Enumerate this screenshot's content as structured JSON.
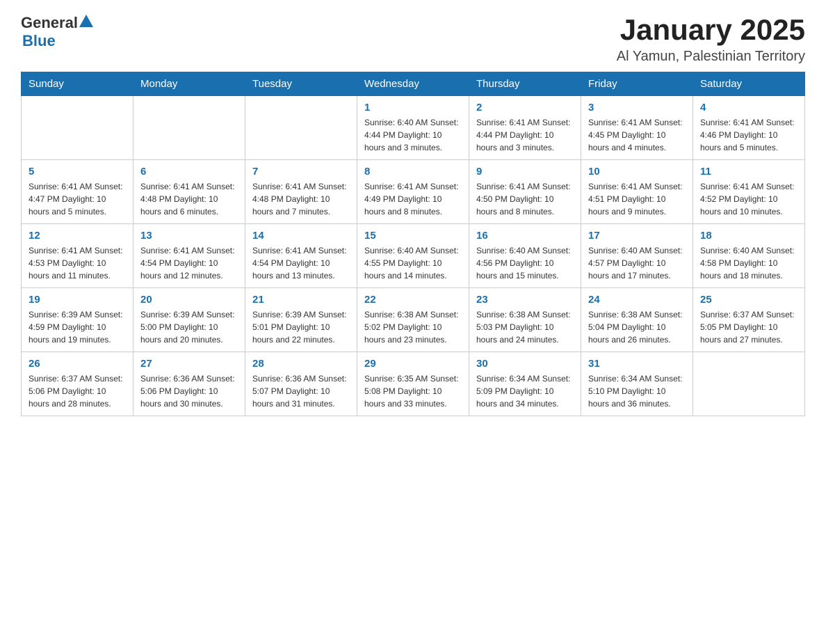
{
  "header": {
    "logo_general": "General",
    "logo_blue": "Blue",
    "month_title": "January 2025",
    "location": "Al Yamun, Palestinian Territory"
  },
  "weekdays": [
    "Sunday",
    "Monday",
    "Tuesday",
    "Wednesday",
    "Thursday",
    "Friday",
    "Saturday"
  ],
  "weeks": [
    [
      {
        "day": "",
        "info": ""
      },
      {
        "day": "",
        "info": ""
      },
      {
        "day": "",
        "info": ""
      },
      {
        "day": "1",
        "info": "Sunrise: 6:40 AM\nSunset: 4:44 PM\nDaylight: 10 hours\nand 3 minutes."
      },
      {
        "day": "2",
        "info": "Sunrise: 6:41 AM\nSunset: 4:44 PM\nDaylight: 10 hours\nand 3 minutes."
      },
      {
        "day": "3",
        "info": "Sunrise: 6:41 AM\nSunset: 4:45 PM\nDaylight: 10 hours\nand 4 minutes."
      },
      {
        "day": "4",
        "info": "Sunrise: 6:41 AM\nSunset: 4:46 PM\nDaylight: 10 hours\nand 5 minutes."
      }
    ],
    [
      {
        "day": "5",
        "info": "Sunrise: 6:41 AM\nSunset: 4:47 PM\nDaylight: 10 hours\nand 5 minutes."
      },
      {
        "day": "6",
        "info": "Sunrise: 6:41 AM\nSunset: 4:48 PM\nDaylight: 10 hours\nand 6 minutes."
      },
      {
        "day": "7",
        "info": "Sunrise: 6:41 AM\nSunset: 4:48 PM\nDaylight: 10 hours\nand 7 minutes."
      },
      {
        "day": "8",
        "info": "Sunrise: 6:41 AM\nSunset: 4:49 PM\nDaylight: 10 hours\nand 8 minutes."
      },
      {
        "day": "9",
        "info": "Sunrise: 6:41 AM\nSunset: 4:50 PM\nDaylight: 10 hours\nand 8 minutes."
      },
      {
        "day": "10",
        "info": "Sunrise: 6:41 AM\nSunset: 4:51 PM\nDaylight: 10 hours\nand 9 minutes."
      },
      {
        "day": "11",
        "info": "Sunrise: 6:41 AM\nSunset: 4:52 PM\nDaylight: 10 hours\nand 10 minutes."
      }
    ],
    [
      {
        "day": "12",
        "info": "Sunrise: 6:41 AM\nSunset: 4:53 PM\nDaylight: 10 hours\nand 11 minutes."
      },
      {
        "day": "13",
        "info": "Sunrise: 6:41 AM\nSunset: 4:54 PM\nDaylight: 10 hours\nand 12 minutes."
      },
      {
        "day": "14",
        "info": "Sunrise: 6:41 AM\nSunset: 4:54 PM\nDaylight: 10 hours\nand 13 minutes."
      },
      {
        "day": "15",
        "info": "Sunrise: 6:40 AM\nSunset: 4:55 PM\nDaylight: 10 hours\nand 14 minutes."
      },
      {
        "day": "16",
        "info": "Sunrise: 6:40 AM\nSunset: 4:56 PM\nDaylight: 10 hours\nand 15 minutes."
      },
      {
        "day": "17",
        "info": "Sunrise: 6:40 AM\nSunset: 4:57 PM\nDaylight: 10 hours\nand 17 minutes."
      },
      {
        "day": "18",
        "info": "Sunrise: 6:40 AM\nSunset: 4:58 PM\nDaylight: 10 hours\nand 18 minutes."
      }
    ],
    [
      {
        "day": "19",
        "info": "Sunrise: 6:39 AM\nSunset: 4:59 PM\nDaylight: 10 hours\nand 19 minutes."
      },
      {
        "day": "20",
        "info": "Sunrise: 6:39 AM\nSunset: 5:00 PM\nDaylight: 10 hours\nand 20 minutes."
      },
      {
        "day": "21",
        "info": "Sunrise: 6:39 AM\nSunset: 5:01 PM\nDaylight: 10 hours\nand 22 minutes."
      },
      {
        "day": "22",
        "info": "Sunrise: 6:38 AM\nSunset: 5:02 PM\nDaylight: 10 hours\nand 23 minutes."
      },
      {
        "day": "23",
        "info": "Sunrise: 6:38 AM\nSunset: 5:03 PM\nDaylight: 10 hours\nand 24 minutes."
      },
      {
        "day": "24",
        "info": "Sunrise: 6:38 AM\nSunset: 5:04 PM\nDaylight: 10 hours\nand 26 minutes."
      },
      {
        "day": "25",
        "info": "Sunrise: 6:37 AM\nSunset: 5:05 PM\nDaylight: 10 hours\nand 27 minutes."
      }
    ],
    [
      {
        "day": "26",
        "info": "Sunrise: 6:37 AM\nSunset: 5:06 PM\nDaylight: 10 hours\nand 28 minutes."
      },
      {
        "day": "27",
        "info": "Sunrise: 6:36 AM\nSunset: 5:06 PM\nDaylight: 10 hours\nand 30 minutes."
      },
      {
        "day": "28",
        "info": "Sunrise: 6:36 AM\nSunset: 5:07 PM\nDaylight: 10 hours\nand 31 minutes."
      },
      {
        "day": "29",
        "info": "Sunrise: 6:35 AM\nSunset: 5:08 PM\nDaylight: 10 hours\nand 33 minutes."
      },
      {
        "day": "30",
        "info": "Sunrise: 6:34 AM\nSunset: 5:09 PM\nDaylight: 10 hours\nand 34 minutes."
      },
      {
        "day": "31",
        "info": "Sunrise: 6:34 AM\nSunset: 5:10 PM\nDaylight: 10 hours\nand 36 minutes."
      },
      {
        "day": "",
        "info": ""
      }
    ]
  ],
  "colors": {
    "header_bg": "#1a6faf",
    "header_text": "#ffffff",
    "day_number": "#1a6faf",
    "border": "#cccccc"
  }
}
